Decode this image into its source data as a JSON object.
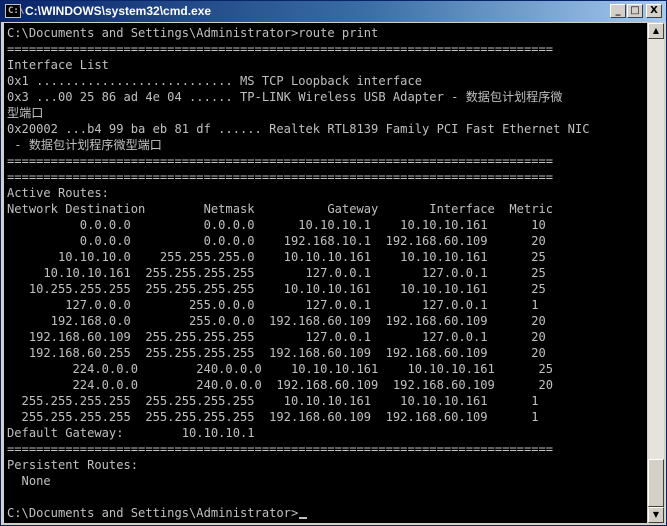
{
  "window": {
    "title": "C:\\WINDOWS\\system32\\cmd.exe",
    "icon_label": "C:\\",
    "buttons": {
      "minimize": "_",
      "maximize": "□",
      "close": "X"
    }
  },
  "scrollbar": {
    "up_arrow": "▲",
    "down_arrow": "▼"
  },
  "console": {
    "lines": [
      "C:\\Documents and Settings\\Administrator>route print",
      "===========================================================================",
      "Interface List",
      "0x1 ........................... MS TCP Loopback interface",
      "0x3 ...00 25 86 ad 4e 04 ...... TP-LINK Wireless USB Adapter - 数据包计划程序微",
      "型端口",
      "0x20002 ...b4 99 ba eb 81 df ...... Realtek RTL8139 Family PCI Fast Ethernet NIC",
      " - 数据包计划程序微型端口",
      "===========================================================================",
      "===========================================================================",
      "Active Routes:",
      "Network Destination        Netmask          Gateway       Interface  Metric",
      "          0.0.0.0          0.0.0.0      10.10.10.1    10.10.10.161      10",
      "          0.0.0.0          0.0.0.0    192.168.10.1  192.168.60.109      20",
      "       10.10.10.0    255.255.255.0    10.10.10.161    10.10.10.161      25",
      "     10.10.10.161  255.255.255.255       127.0.0.1       127.0.0.1      25",
      "   10.255.255.255  255.255.255.255    10.10.10.161    10.10.10.161      25",
      "        127.0.0.0        255.0.0.0       127.0.0.1       127.0.0.1      1",
      "      192.168.0.0        255.0.0.0  192.168.60.109  192.168.60.109      20",
      "   192.168.60.109  255.255.255.255       127.0.0.1       127.0.0.1      20",
      "   192.168.60.255  255.255.255.255  192.168.60.109  192.168.60.109      20",
      "         224.0.0.0        240.0.0.0    10.10.10.161    10.10.10.161      25",
      "         224.0.0.0        240.0.0.0  192.168.60.109  192.168.60.109      20",
      "  255.255.255.255  255.255.255.255    10.10.10.161    10.10.10.161      1",
      "  255.255.255.255  255.255.255.255  192.168.60.109  192.168.60.109      1",
      "Default Gateway:        10.10.10.1",
      "===========================================================================",
      "Persistent Routes:",
      "  None",
      "",
      "C:\\Documents and Settings\\Administrator>"
    ]
  },
  "colors": {
    "console_bg": "#000000",
    "console_text": "#c0c0c0",
    "title_active": "#0a246a"
  }
}
